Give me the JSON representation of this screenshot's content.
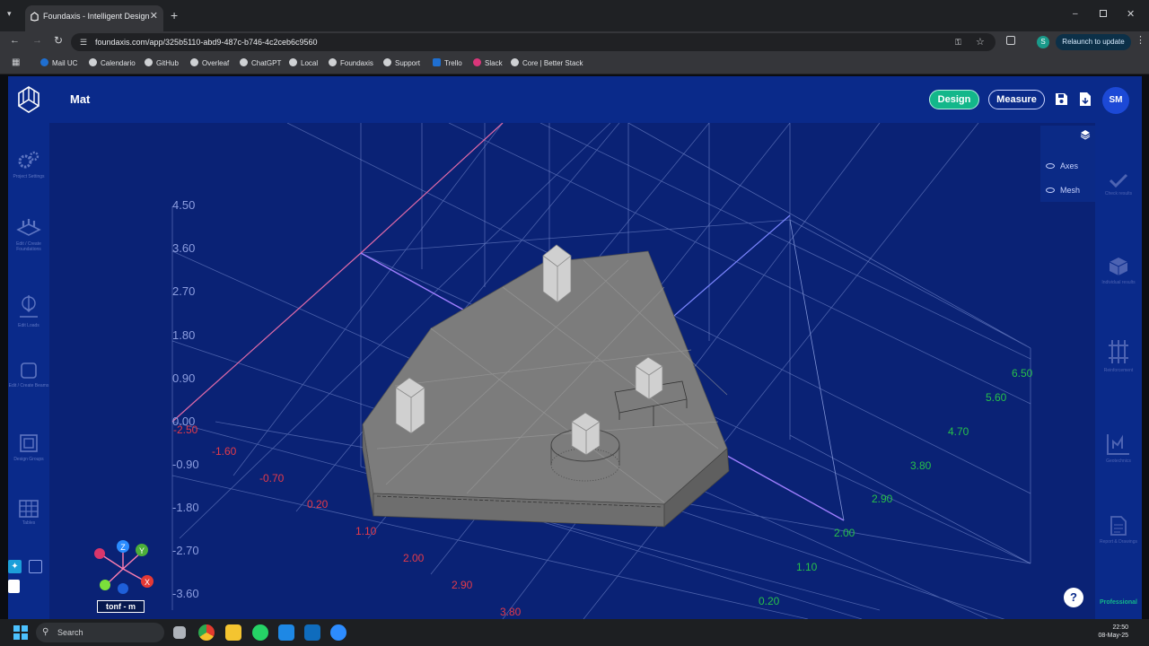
{
  "browser": {
    "tab_title": "Foundaxis - Intelligent Design",
    "new_tab": "+",
    "url": "foundaxis.com/app/325b5110-abd9-487c-b746-4c2ceb6c9560",
    "relaunch": "Relaunch to update",
    "profile_initial": "S",
    "bookmarks": [
      "Mail UC",
      "Calendario",
      "GitHub",
      "Overleaf",
      "ChatGPT",
      "Local",
      "Foundaxis",
      "Support",
      "Trello",
      "Slack",
      "Core | Better Stack"
    ]
  },
  "app": {
    "title": "Mat",
    "design_label": "Design",
    "measure_label": "Measure",
    "user_initials": "SM",
    "accent": "#13b78a",
    "header_color": "#0a2a8a"
  },
  "left_sidebar": [
    {
      "label": "Project Settings",
      "icon": "gears-icon"
    },
    {
      "label": "Edit / Create Foundations",
      "icon": "foundation-icon"
    },
    {
      "label": "Edit Loads",
      "icon": "load-icon"
    },
    {
      "label": "Edit / Create Beams",
      "icon": "square-icon"
    },
    {
      "label": "Design Groups",
      "icon": "design-groups-icon"
    },
    {
      "label": "Tables",
      "icon": "table-icon"
    }
  ],
  "right_sidebar": [
    {
      "label": "Check results",
      "icon": "check-icon"
    },
    {
      "label": "Individual results",
      "icon": "cube-icon"
    },
    {
      "label": "Reinforcement",
      "icon": "reinforcement-icon"
    },
    {
      "label": "Geotechnics",
      "icon": "geotechnics-icon"
    },
    {
      "label": "Report & Drawings",
      "icon": "document-icon"
    },
    {
      "label": "Professional",
      "icon": ""
    }
  ],
  "layers_panel": {
    "axes": "Axes",
    "mesh": "Mesh"
  },
  "axis_labels": {
    "z": [
      "4.50",
      "3.60",
      "2.70",
      "1.80",
      "0.90",
      "0.00",
      "-0.90",
      "-1.80",
      "-2.70",
      "-3.60"
    ],
    "x": [
      "-2.50",
      "-1.60",
      "-0.70",
      "0.20",
      "1.10",
      "2.00",
      "2.90",
      "3.80"
    ],
    "y": [
      "6.50",
      "5.60",
      "4.70",
      "3.80",
      "2.90",
      "2.00",
      "1.10",
      "0.20"
    ]
  },
  "gizmo": {
    "z": "Z",
    "y": "Y",
    "x": "X",
    "units": "tonf - m"
  },
  "help": "?",
  "taskbar": {
    "search": "Search",
    "time": "22:50",
    "date": "08-May-25"
  }
}
